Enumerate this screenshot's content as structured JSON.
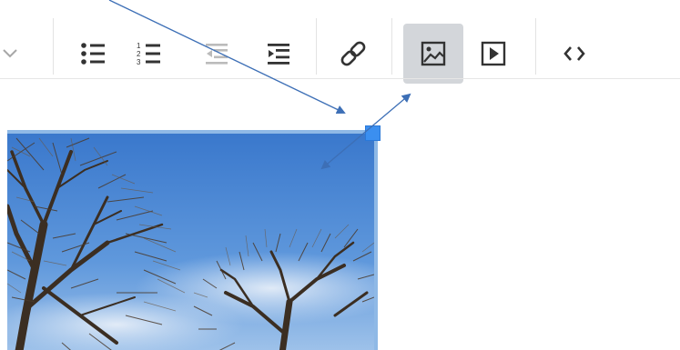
{
  "toolbar": {
    "buttons": [
      {
        "name": "chevron-down",
        "active": false
      },
      {
        "name": "bulleted-list",
        "active": false
      },
      {
        "name": "numbered-list",
        "active": false,
        "list_digits": [
          "1",
          "2",
          "3"
        ]
      },
      {
        "name": "decrease-indent",
        "active": false
      },
      {
        "name": "increase-indent",
        "active": false
      },
      {
        "name": "insert-link",
        "active": true
      },
      {
        "name": "insert-image",
        "active": true
      },
      {
        "name": "insert-media",
        "active": false
      },
      {
        "name": "source-code",
        "active": false
      }
    ]
  },
  "image": {
    "description_icon": "image-of-bare-trees-under-blue-sky",
    "selected": true
  },
  "annotations": {
    "arrow_color": "#3d6fb6"
  },
  "colors": {
    "toolbar_icon": "#333333",
    "disabled_icon": "#bbbbbb",
    "active_button_bg": "#d3d6da",
    "selection_border": "#8fb9e6",
    "resize_handle": "#3b8ff0",
    "sky_top": "#3f7fd0",
    "sky_bottom": "#9dc2ea"
  }
}
